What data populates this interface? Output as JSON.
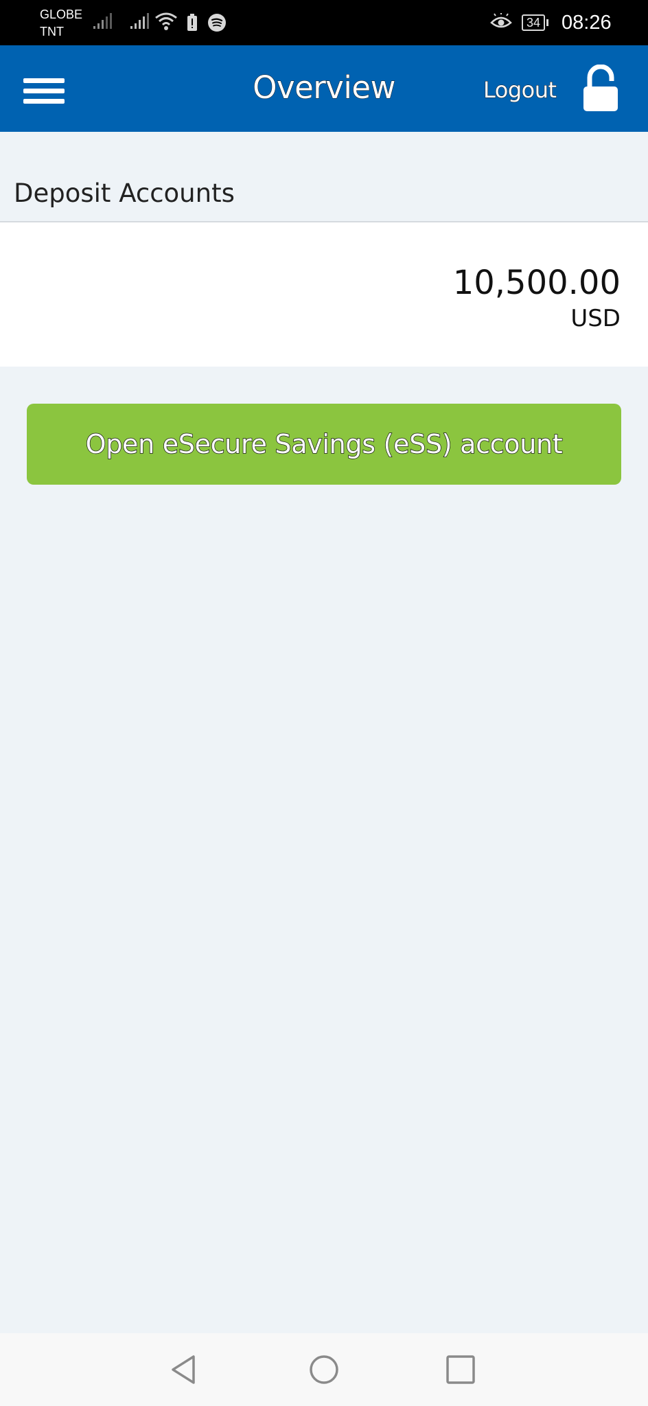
{
  "status_bar": {
    "carrier_line1": "GLOBE",
    "carrier_line2": "TNT",
    "battery_level": "34",
    "time": "08:26",
    "icons": [
      "signal-icon",
      "signal-icon",
      "wifi-icon",
      "battery-icon",
      "spotify-icon",
      "eye-icon"
    ]
  },
  "header": {
    "title": "Overview",
    "logout_label": "Logout",
    "menu_icon": "hamburger-menu-icon",
    "lock_icon": "unlocked-padlock-icon",
    "background_color": "#0062b1"
  },
  "deposit_accounts": {
    "section_title": "Deposit Accounts",
    "accounts": [
      {
        "balance": "10,500.00",
        "currency": "USD"
      }
    ]
  },
  "cta": {
    "label": "Open eSecure Savings (eSS) account",
    "color": "#8bc53f"
  },
  "nav_bar": {
    "icons": [
      "back-icon",
      "home-icon",
      "recent-apps-icon"
    ]
  }
}
